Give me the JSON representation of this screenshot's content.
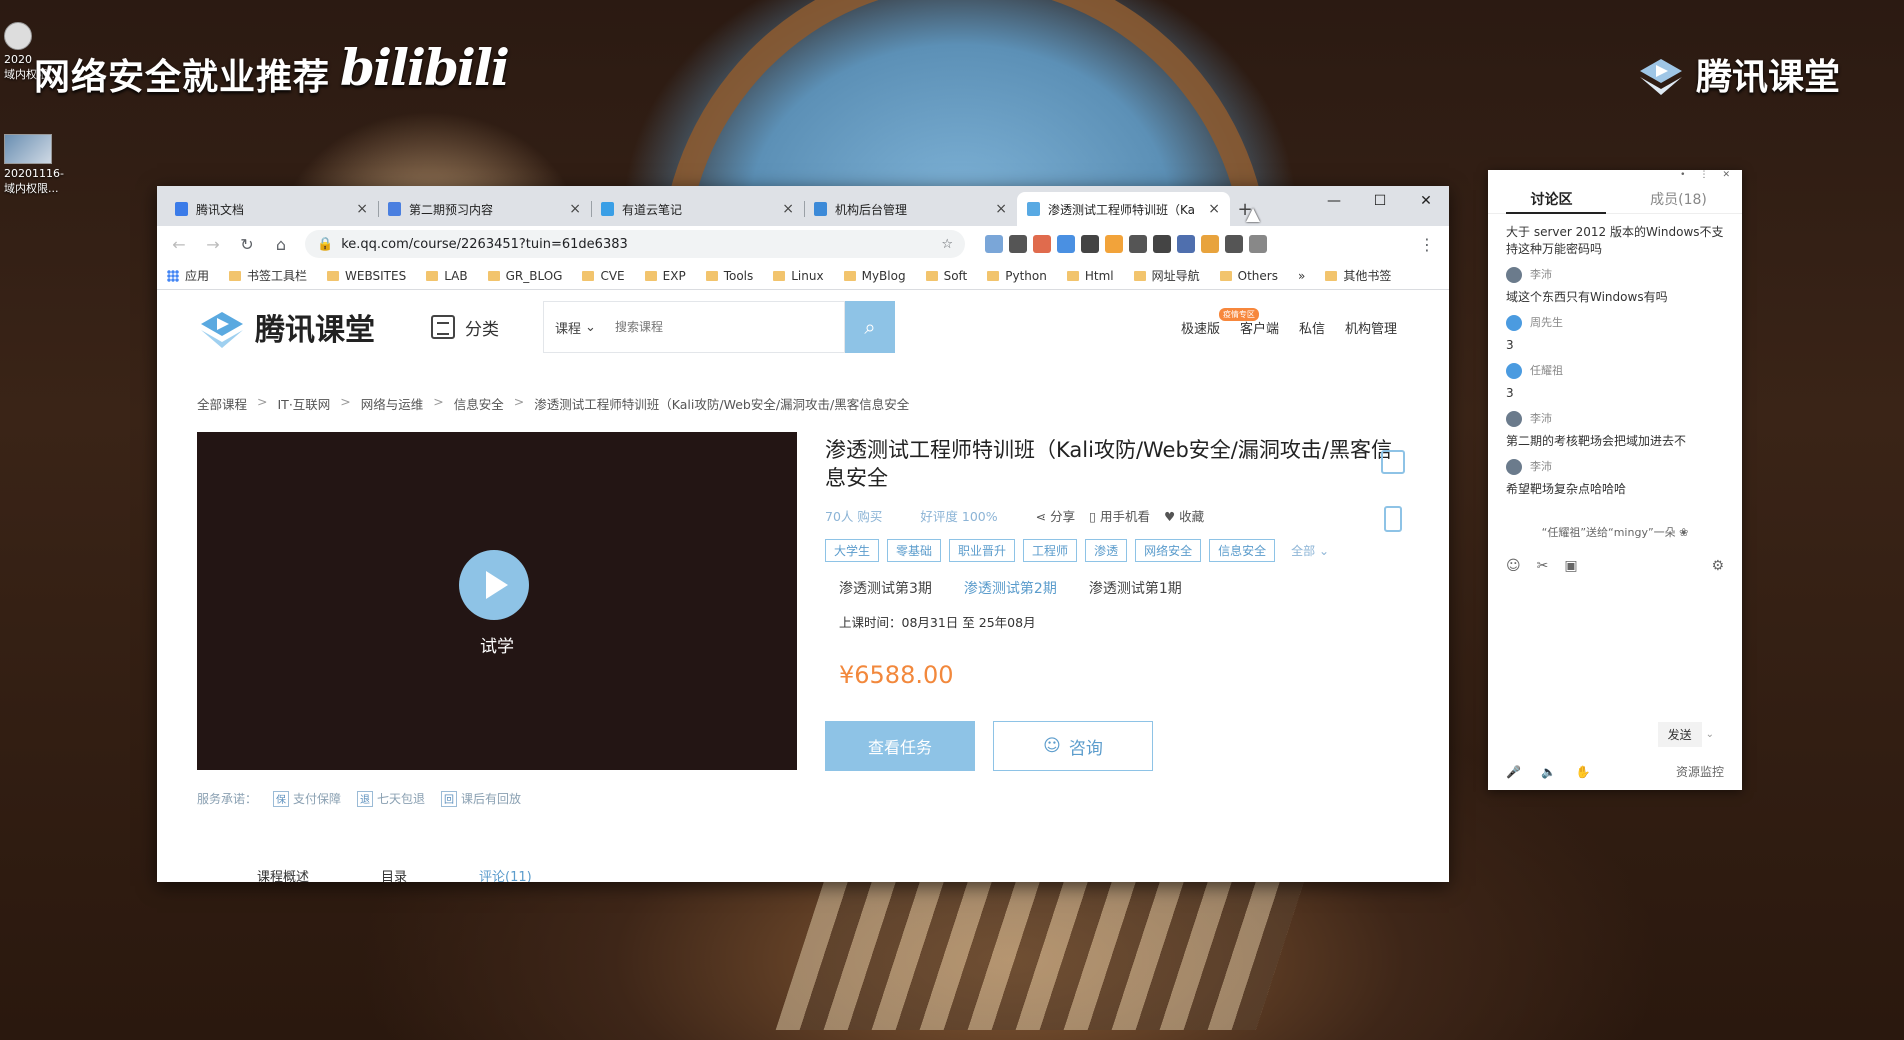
{
  "desktop": {
    "overlay_title": "网络安全就业推荐",
    "bili_logo": "bilibili",
    "brand": "腾讯课堂",
    "icons": [
      {
        "label": "2020\n域内权限..."
      },
      {
        "label": "20201116-\n域内权限..."
      }
    ]
  },
  "browser": {
    "tabs": [
      {
        "label": "腾讯文档",
        "icon_color": "#3b7be8",
        "active": false
      },
      {
        "label": "第二期预习内容",
        "icon_color": "#4a7fe0",
        "active": false
      },
      {
        "label": "有道云笔记",
        "icon_color": "#3a9fe6",
        "active": false
      },
      {
        "label": "机构后台管理",
        "icon_color": "#3c8ad8",
        "active": false
      },
      {
        "label": "渗透测试工程师特训班（Ka",
        "icon_color": "#58a9e3",
        "active": true
      }
    ],
    "window_controls": {
      "minimize": "—",
      "maximize": "☐",
      "close": "✕"
    },
    "address": "ke.qq.com/course/2263451?tuin=61de6383",
    "bookmarks": [
      "应用",
      "书签工具栏",
      "WEBSITES",
      "LAB",
      "GR_BLOG",
      "CVE",
      "EXP",
      "Tools",
      "Linux",
      "MyBlog",
      "Soft",
      "Python",
      "Html",
      "网址导航",
      "Others"
    ],
    "bookmarks_overflow": "»",
    "other_bookmarks": "其他书签",
    "extension_colors": [
      "#7aa6d8",
      "#555",
      "#e06b4d",
      "#4a90e2",
      "#444",
      "#f2a33a",
      "#555",
      "#444",
      "#4f6fae",
      "#e8a33d",
      "#555",
      "#888"
    ]
  },
  "page": {
    "brand": "腾讯课堂",
    "category": "分类",
    "search": {
      "scope": "课程",
      "placeholder": "搜索课程"
    },
    "header_links": {
      "jisu": "极速版",
      "jisu_badge": "疫情专区",
      "client": "客户端",
      "message": "私信",
      "admin": "机构管理"
    },
    "breadcrumbs": [
      "全部课程",
      "IT·互联网",
      "网络与运维",
      "信息安全",
      "渗透测试工程师特训班（Kali攻防/Web安全/漏洞攻击/黑客信息安全"
    ],
    "player": {
      "play_label": "试学"
    },
    "promise": {
      "label": "服务承诺：",
      "items": [
        {
          "icon": "保",
          "label": "支付保障"
        },
        {
          "icon": "退",
          "label": "七天包退"
        },
        {
          "icon": "回",
          "label": "课后有回放"
        }
      ]
    },
    "course": {
      "title": "渗透测试工程师特训班（Kali攻防/Web安全/漏洞攻击/黑客信息安全",
      "buyers": "70人 购买",
      "rating": "好评度 100%",
      "share": "分享",
      "mobile": "用手机看",
      "favorite": "收藏",
      "tags": [
        "大学生",
        "零基础",
        "职业晋升",
        "工程师",
        "渗透",
        "网络安全",
        "信息安全"
      ],
      "tags_all": "全部",
      "terms": [
        {
          "label": "渗透测试第3期",
          "selected": false
        },
        {
          "label": "渗透测试第2期",
          "selected": true
        },
        {
          "label": "渗透测试第1期",
          "selected": false
        }
      ],
      "schedule": "上课时间：08月31日 至 25年08月",
      "price": "¥6588.00",
      "view_btn": "查看任务",
      "consult_btn": "咨询"
    },
    "page_tabs": [
      "课程概述",
      "目录",
      "评论(11)"
    ]
  },
  "panel": {
    "top_controls": [
      "•",
      "⋮",
      "✕"
    ],
    "tab_discussion": "讨论区",
    "tab_members": "成员(18)",
    "messages": [
      {
        "name": "",
        "text": "大于 server 2012 版本的Windows不支持这种万能密码吗"
      },
      {
        "name": "李沛",
        "text": "域这个东西只有Windows有吗"
      },
      {
        "name": "周先生",
        "text": "3"
      },
      {
        "name": "任耀祖",
        "text": "3"
      },
      {
        "name": "李沛",
        "text": "第二期的考核靶场会把域加进去不"
      },
      {
        "name": "李沛",
        "text": "希望靶场复杂点哈哈哈"
      }
    ],
    "gift": "“任耀祖”送给“mingy”一朵",
    "send": "发送",
    "monitor": "资源监控"
  }
}
